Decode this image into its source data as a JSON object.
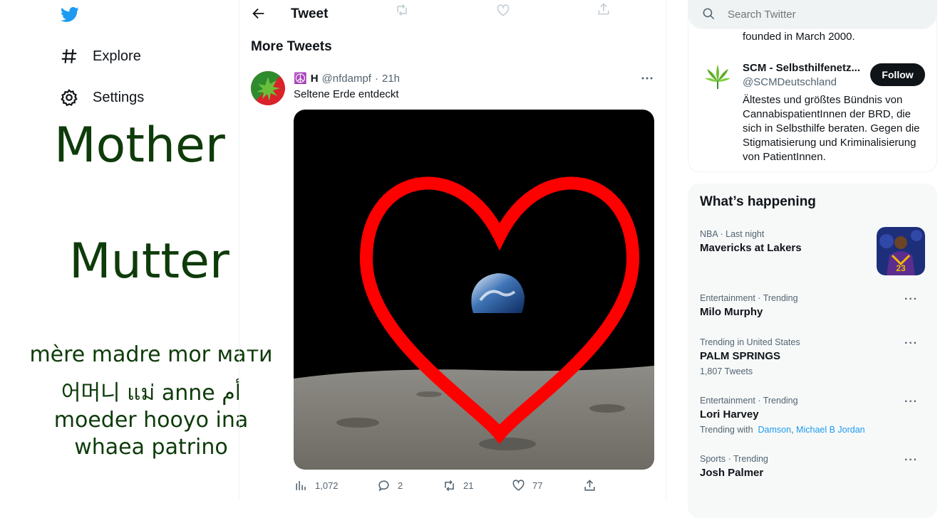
{
  "nav": {
    "explore": "Explore",
    "settings": "Settings"
  },
  "overlay": {
    "line1": "Mother",
    "line2": "Mutter",
    "line3": "mère madre mor мати",
    "line4": "어머니 แม่ anne أم",
    "line5": "moeder hooyo ina",
    "line6": "whaea patrino"
  },
  "header": {
    "title": "Tweet",
    "section": "More Tweets"
  },
  "tweet": {
    "name_emoji": "☮️",
    "name": "H",
    "handle": "@nfdampf",
    "dot": "·",
    "time": "21h",
    "text": "Seltene Erde entdeckt",
    "views": "1,072",
    "replies": "2",
    "retweets": "21",
    "likes": "77"
  },
  "search": {
    "placeholder": "Search Twitter"
  },
  "follow_card": {
    "prev_tail": "founded in March 2000.",
    "account_name": "SCM - Selbsthilfenetz...",
    "account_handle": "@SCMDeutschland",
    "follow_label": "Follow",
    "bio": "Ältestes und größtes Bündnis von CannabispatientInnen der BRD, die sich in Selbsthilfe beraten. Gegen die Stigmatisierung und Kriminalisierung von PatientInnen."
  },
  "trends": {
    "heading": "What’s happening",
    "items": [
      {
        "meta_a": "NBA",
        "meta_sep": "·",
        "meta_b": "Last night",
        "title": "Mavericks at Lakers"
      },
      {
        "meta": "Entertainment · Trending",
        "title": "Milo Murphy"
      },
      {
        "meta": "Trending in United States",
        "title": "PALM SPRINGS",
        "sub": "1,807 Tweets"
      },
      {
        "meta": "Entertainment · Trending",
        "title": "Lori Harvey",
        "sub_prefix": "Trending with",
        "sub_link1": "Damson",
        "sub_comma": ",",
        "sub_link2": "Michael B Jordan"
      },
      {
        "meta": "Sports · Trending",
        "title": "Josh Palmer"
      }
    ],
    "jersey_number": "23"
  },
  "colors": {
    "twitter_blue": "#1d9bf0",
    "overlay_green": "#0e3b0a",
    "heart_red": "#ff0000"
  },
  "icons": [
    "twitter-logo-icon",
    "hashtag-icon",
    "gear-icon",
    "back-arrow-icon",
    "more-icon",
    "views-icon",
    "reply-icon",
    "retweet-icon",
    "like-icon",
    "share-icon",
    "search-icon",
    "cannabis-leaf-icon"
  ]
}
